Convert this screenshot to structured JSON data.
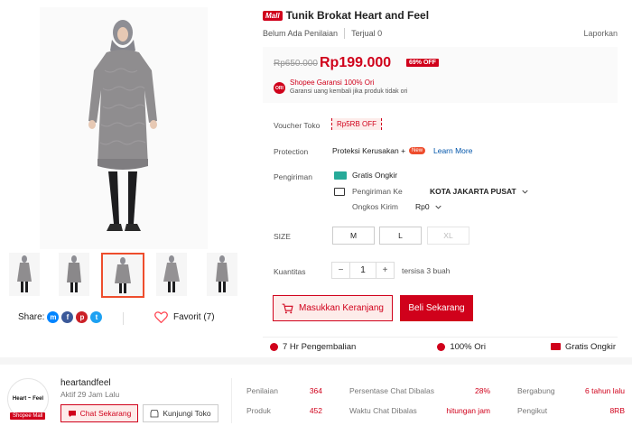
{
  "product": {
    "mall_badge": "Mall",
    "title": "Tunik Brokat Heart and Feel",
    "rating_text": "Belum Ada Penilaian",
    "sold_count": "0",
    "sold_label": "Terjual 0",
    "report": "Laporkan",
    "old_price": "Rp650.000",
    "price": "Rp199.000",
    "discount": "69% OFF",
    "ori_badge": "ORI",
    "guarantee_title": "Shopee Garansi 100% Ori",
    "guarantee_sub": "Garansi uang kembali jika produk tidak ori"
  },
  "voucher": {
    "label": "Voucher Toko",
    "value": "Rp5RB OFF"
  },
  "protection": {
    "label": "Protection",
    "value": "Proteksi Kerusakan +",
    "new_badge": "New",
    "learn_more": "Learn More"
  },
  "shipping": {
    "label": "Pengiriman",
    "free": "Gratis Ongkir",
    "to_label": "Pengiriman Ke",
    "to_value": "KOTA JAKARTA PUSAT",
    "cost_label": "Ongkos Kirim",
    "cost_value": "Rp0"
  },
  "size": {
    "label": "SIZE",
    "options": [
      "M",
      "L",
      "XL"
    ]
  },
  "quantity": {
    "label": "Kuantitas",
    "minus": "−",
    "value": "1",
    "plus": "+",
    "stock": "tersisa 3 buah"
  },
  "actions": {
    "add_to_cart": "Masukkan Keranjang",
    "buy_now": "Beli Sekarang"
  },
  "guarantees": [
    "7 Hr Pengembalian",
    "100% Ori",
    "Gratis Ongkir"
  ],
  "share": {
    "label": "Share:",
    "favorite": "Favorit (7)"
  },
  "shop": {
    "logo_text": "Heart ~ Feel",
    "mall_badge": "Shopee Mall",
    "name": "heartandfeel",
    "active": "Aktif 29 Jam Lalu",
    "chat_button": "Chat Sekarang",
    "visit_button": "Kunjungi Toko",
    "stats": [
      {
        "label": "Penilaian",
        "value": "364"
      },
      {
        "label": "Produk",
        "value": "452"
      },
      {
        "label": "Persentase Chat Dibalas",
        "value": "28%"
      },
      {
        "label": "Waktu Chat Dibalas",
        "value": "hitungan jam"
      },
      {
        "label": "Bergabung",
        "value": "6 tahun lalu"
      },
      {
        "label": "Pengikut",
        "value": "8RB"
      }
    ]
  },
  "colors": {
    "accent": "#d0011b",
    "teal": "#26aa99",
    "link": "#0055aa"
  }
}
